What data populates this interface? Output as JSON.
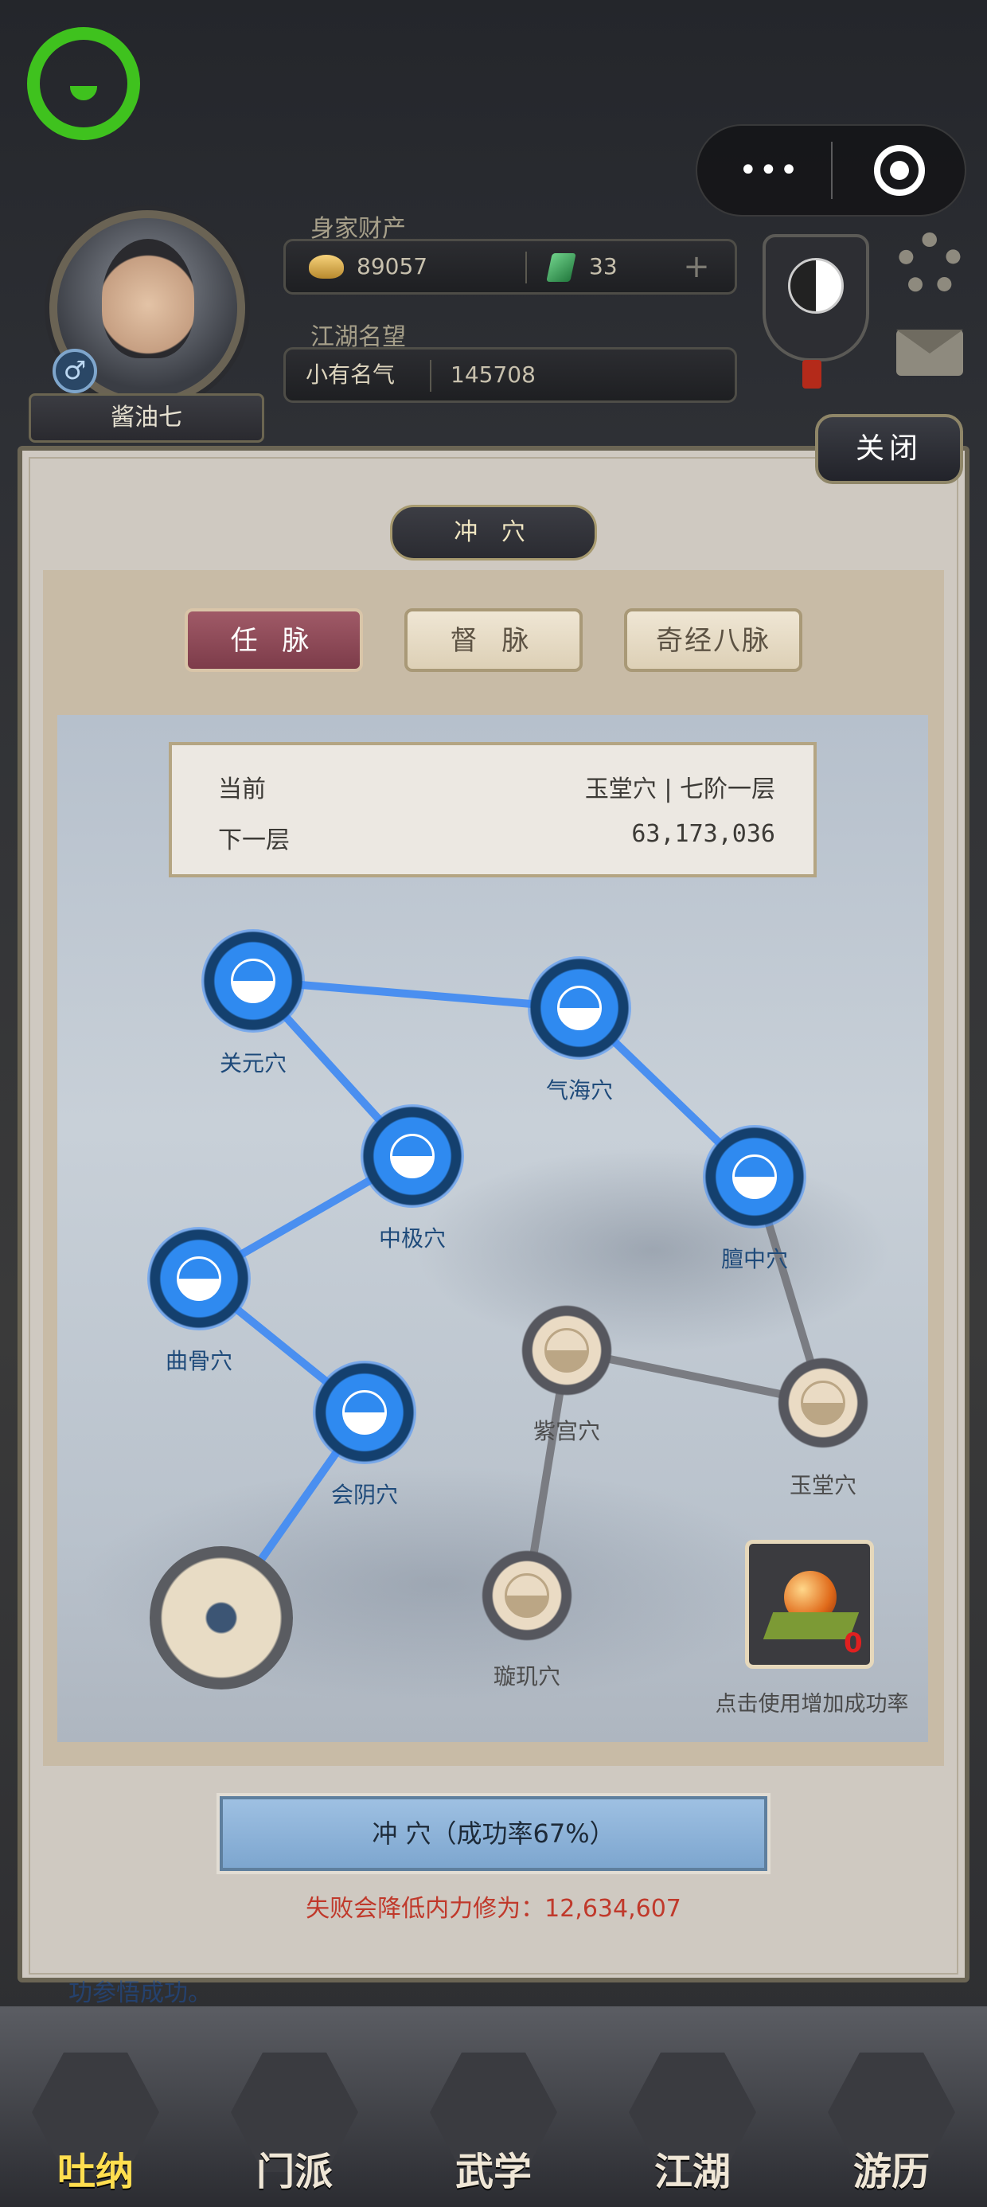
{
  "player": {
    "name": "酱油七",
    "gender_symbol": "♂",
    "assets_label": "身家财产",
    "gold": "89057",
    "jade": "33",
    "fame_label": "江湖名望",
    "fame_title": "小有名气",
    "fame_value": "145708"
  },
  "top_bar": {
    "more": "•••"
  },
  "modal": {
    "close_label": "关闭",
    "title": "冲 穴",
    "tabs": [
      {
        "label": "任 脉",
        "active": true
      },
      {
        "label": "督 脉",
        "active": false
      },
      {
        "label": "奇经八脉",
        "active": false
      }
    ],
    "info": {
      "current_label": "当前",
      "current_value": "玉堂穴 | 七阶一层",
      "next_label": "下一层",
      "next_value": "63,173,036"
    },
    "nodes": [
      {
        "label": "关元穴",
        "state": "lit"
      },
      {
        "label": "气海穴",
        "state": "lit"
      },
      {
        "label": "中极穴",
        "state": "lit"
      },
      {
        "label": "膻中穴",
        "state": "lit"
      },
      {
        "label": "曲骨穴",
        "state": "lit"
      },
      {
        "label": "紫宫穴",
        "state": "dim"
      },
      {
        "label": "玉堂穴",
        "state": "dim"
      },
      {
        "label": "会阴穴",
        "state": "lit"
      },
      {
        "label": "璇玑穴",
        "state": "dim"
      }
    ],
    "item": {
      "count": "0",
      "hint": "点击使用增加成功率"
    },
    "breach_button": "冲 穴（成功率67%）",
    "fail_text": "失败会降低内力修为：12,634,607"
  },
  "behind_log": "功参悟成功。",
  "nav": [
    {
      "label": "吐纳",
      "active": true
    },
    {
      "label": "门派",
      "active": false
    },
    {
      "label": "武学",
      "active": false
    },
    {
      "label": "江湖",
      "active": false
    },
    {
      "label": "游历",
      "active": false
    }
  ],
  "colors": {
    "lit_node": "#2f8af0",
    "active_tab": "#8e4a58",
    "fail_text": "#c0392b",
    "link_line": "#4a8ff0"
  }
}
